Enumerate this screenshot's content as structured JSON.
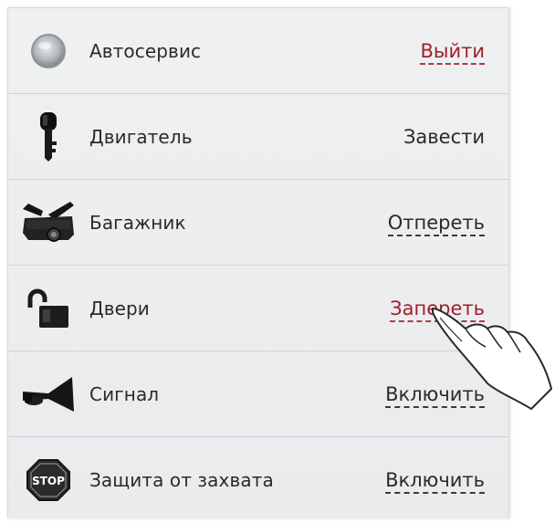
{
  "rows": [
    {
      "icon": "service-light-icon",
      "label": "Автосервис",
      "action": "Выйти"
    },
    {
      "icon": "car-key-icon",
      "label": "Двигатель",
      "action": "Завести"
    },
    {
      "icon": "car-trunk-icon",
      "label": "Багажник",
      "action": "Отпереть"
    },
    {
      "icon": "padlock-open-icon",
      "label": "Двери",
      "action": "Запереть"
    },
    {
      "icon": "horn-icon",
      "label": "Сигнал",
      "action": "Включить"
    },
    {
      "icon": "stop-sign-icon",
      "label": "Защита от захвата",
      "action": "Включить"
    }
  ],
  "stop_sign_text": "STOP",
  "colors": {
    "accent_red": "#a0202a",
    "panel_bg": "#eceef0",
    "divider": "#cfd3d7"
  },
  "cursor": "pointing-hand-cursor"
}
